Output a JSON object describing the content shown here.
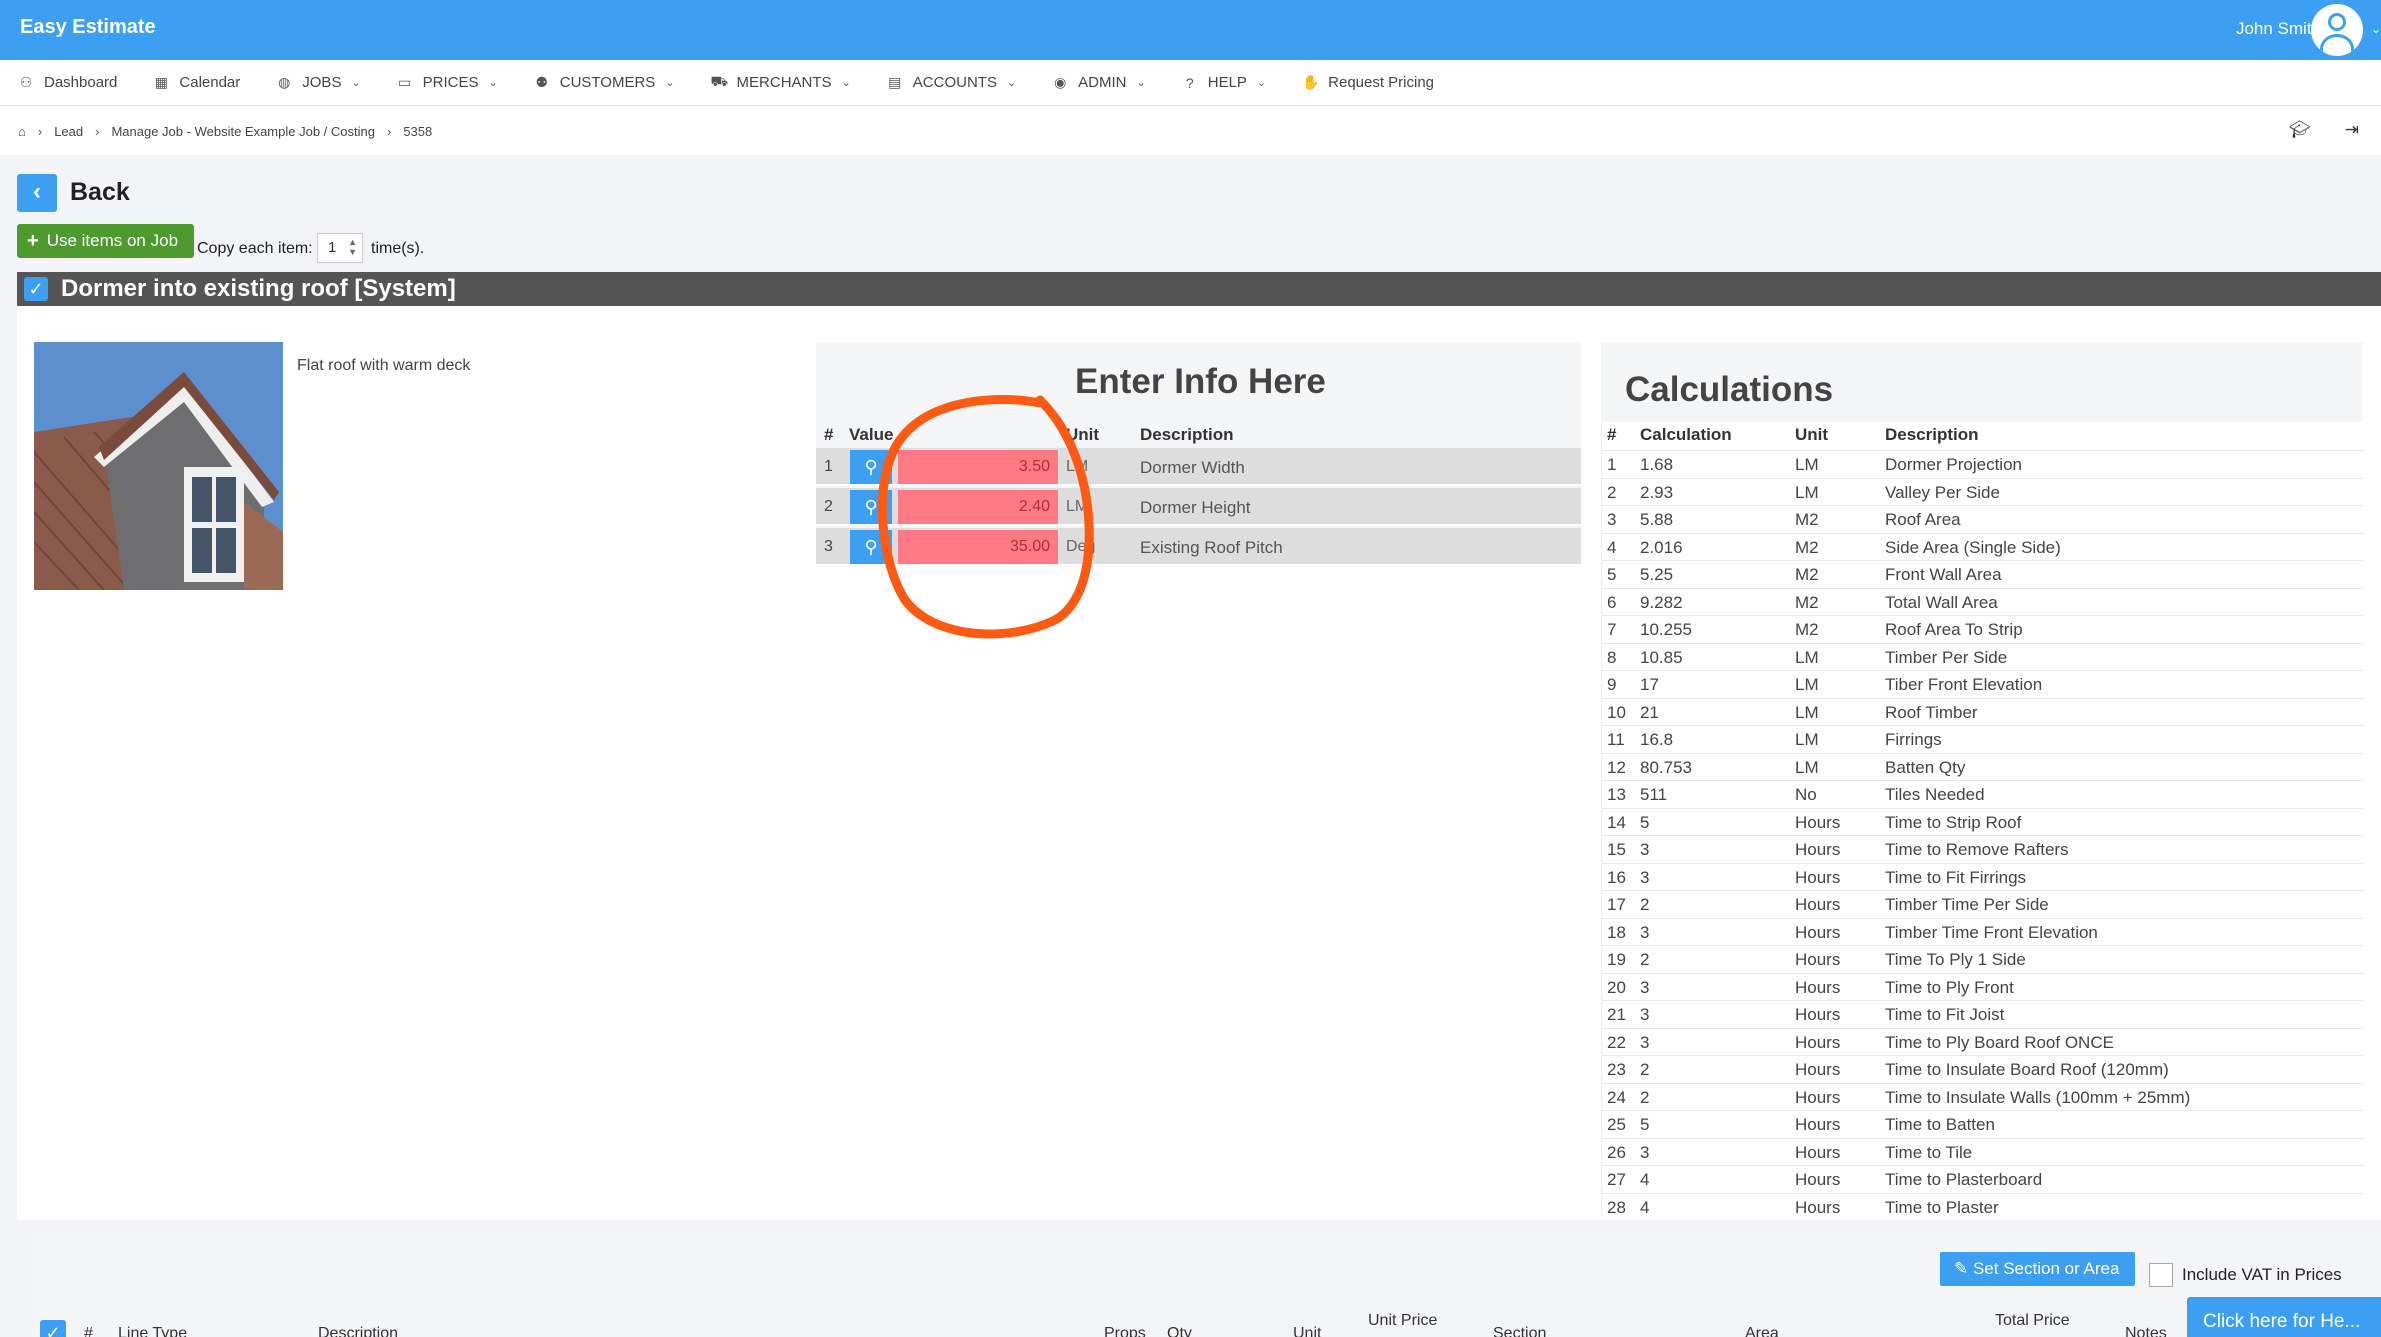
{
  "app": {
    "title": "Easy Estimate",
    "user_name": "John Smith"
  },
  "nav": [
    {
      "label": "Dashboard",
      "icon": "dashboard-icon",
      "glyph": "⚇",
      "caret": false
    },
    {
      "label": "Calendar",
      "icon": "calendar-icon",
      "glyph": "▦",
      "caret": false
    },
    {
      "label": "JOBS",
      "icon": "globe-icon",
      "glyph": "◍",
      "caret": true
    },
    {
      "label": "PRICES",
      "icon": "money-icon",
      "glyph": "▭",
      "caret": true
    },
    {
      "label": "CUSTOMERS",
      "icon": "users-icon",
      "glyph": "⚉",
      "caret": true
    },
    {
      "label": "MERCHANTS",
      "icon": "cart-icon",
      "glyph": "⛟",
      "caret": true
    },
    {
      "label": "ACCOUNTS",
      "icon": "accounts-icon",
      "glyph": "▤",
      "caret": true
    },
    {
      "label": "ADMIN",
      "icon": "admin-icon",
      "glyph": "◉",
      "caret": true
    },
    {
      "label": "HELP",
      "icon": "question-icon",
      "glyph": "?",
      "caret": true
    },
    {
      "label": "Request Pricing",
      "icon": "handshake-icon",
      "glyph": "✋",
      "caret": false
    }
  ],
  "breadcrumb": [
    "Lead",
    "Manage Job - Website Example Job / Costing",
    "5358"
  ],
  "back_label": "Back",
  "use_items_label": "Use items on Job",
  "copy_label": "Copy each item:",
  "copy_value": "1",
  "times_label": "time(s).",
  "section_title": "Dormer into existing roof [System]",
  "item_description": "Flat roof with warm deck",
  "info": {
    "title": "Enter Info Here",
    "headers": {
      "num": "#",
      "value": "Value",
      "unit": "Unit",
      "desc": "Description"
    },
    "rows": [
      {
        "num": "1",
        "value": "3.50",
        "unit": "LM",
        "desc": "Dormer Width"
      },
      {
        "num": "2",
        "value": "2.40",
        "unit": "LM",
        "desc": "Dormer Height"
      },
      {
        "num": "3",
        "value": "35.00",
        "unit": "Deg",
        "desc": "Existing Roof Pitch"
      }
    ]
  },
  "calc": {
    "title": "Calculations",
    "headers": {
      "num": "#",
      "calc": "Calculation",
      "unit": "Unit",
      "desc": "Description"
    },
    "rows": [
      {
        "num": "1",
        "calc": "1.68",
        "unit": "LM",
        "desc": "Dormer Projection"
      },
      {
        "num": "2",
        "calc": "2.93",
        "unit": "LM",
        "desc": "Valley Per Side"
      },
      {
        "num": "3",
        "calc": "5.88",
        "unit": "M2",
        "desc": "Roof Area"
      },
      {
        "num": "4",
        "calc": "2.016",
        "unit": "M2",
        "desc": "Side Area (Single Side)"
      },
      {
        "num": "5",
        "calc": "5.25",
        "unit": "M2",
        "desc": "Front Wall Area"
      },
      {
        "num": "6",
        "calc": "9.282",
        "unit": "M2",
        "desc": "Total Wall Area"
      },
      {
        "num": "7",
        "calc": "10.255",
        "unit": "M2",
        "desc": "Roof Area To Strip"
      },
      {
        "num": "8",
        "calc": "10.85",
        "unit": "LM",
        "desc": "Timber Per Side"
      },
      {
        "num": "9",
        "calc": "17",
        "unit": "LM",
        "desc": "Tiber Front Elevation"
      },
      {
        "num": "10",
        "calc": "21",
        "unit": "LM",
        "desc": "Roof Timber"
      },
      {
        "num": "11",
        "calc": "16.8",
        "unit": "LM",
        "desc": "Firrings"
      },
      {
        "num": "12",
        "calc": "80.753",
        "unit": "LM",
        "desc": "Batten Qty"
      },
      {
        "num": "13",
        "calc": "511",
        "unit": "No",
        "desc": "Tiles Needed"
      },
      {
        "num": "14",
        "calc": "5",
        "unit": "Hours",
        "desc": "Time to Strip Roof"
      },
      {
        "num": "15",
        "calc": "3",
        "unit": "Hours",
        "desc": "Time to Remove Rafters"
      },
      {
        "num": "16",
        "calc": "3",
        "unit": "Hours",
        "desc": "Time to Fit Firrings"
      },
      {
        "num": "17",
        "calc": "2",
        "unit": "Hours",
        "desc": "Timber Time Per Side"
      },
      {
        "num": "18",
        "calc": "3",
        "unit": "Hours",
        "desc": "Timber Time Front Elevation"
      },
      {
        "num": "19",
        "calc": "2",
        "unit": "Hours",
        "desc": "Time To Ply 1 Side"
      },
      {
        "num": "20",
        "calc": "3",
        "unit": "Hours",
        "desc": "Time to Ply Front"
      },
      {
        "num": "21",
        "calc": "3",
        "unit": "Hours",
        "desc": "Time to Fit Joist"
      },
      {
        "num": "22",
        "calc": "3",
        "unit": "Hours",
        "desc": "Time to Ply Board Roof ONCE"
      },
      {
        "num": "23",
        "calc": "2",
        "unit": "Hours",
        "desc": "Time to Insulate Board Roof (120mm)"
      },
      {
        "num": "24",
        "calc": "2",
        "unit": "Hours",
        "desc": "Time to Insulate Walls (100mm + 25mm)"
      },
      {
        "num": "25",
        "calc": "5",
        "unit": "Hours",
        "desc": "Time to Batten"
      },
      {
        "num": "26",
        "calc": "3",
        "unit": "Hours",
        "desc": "Time to Tile"
      },
      {
        "num": "27",
        "calc": "4",
        "unit": "Hours",
        "desc": "Time to Plasterboard"
      },
      {
        "num": "28",
        "calc": "4",
        "unit": "Hours",
        "desc": "Time to Plaster"
      }
    ]
  },
  "set_section_label": "Set Section or Area",
  "vat_label": "Include VAT in Prices",
  "table_headers": {
    "num": "#",
    "line_type": "Line Type",
    "description": "Description",
    "props": "Props",
    "qty": "Qty",
    "unit": "Unit",
    "unit_price": "Unit Price",
    "section": "Section",
    "area": "Area",
    "total_price": "Total Price",
    "notes": "Notes"
  },
  "help_tab": "Click here for He...",
  "colors": {
    "brand": "#3d9ff2",
    "success": "#4d9a2e",
    "highlight": "#ff7a85",
    "annotation": "#ff5a14"
  }
}
